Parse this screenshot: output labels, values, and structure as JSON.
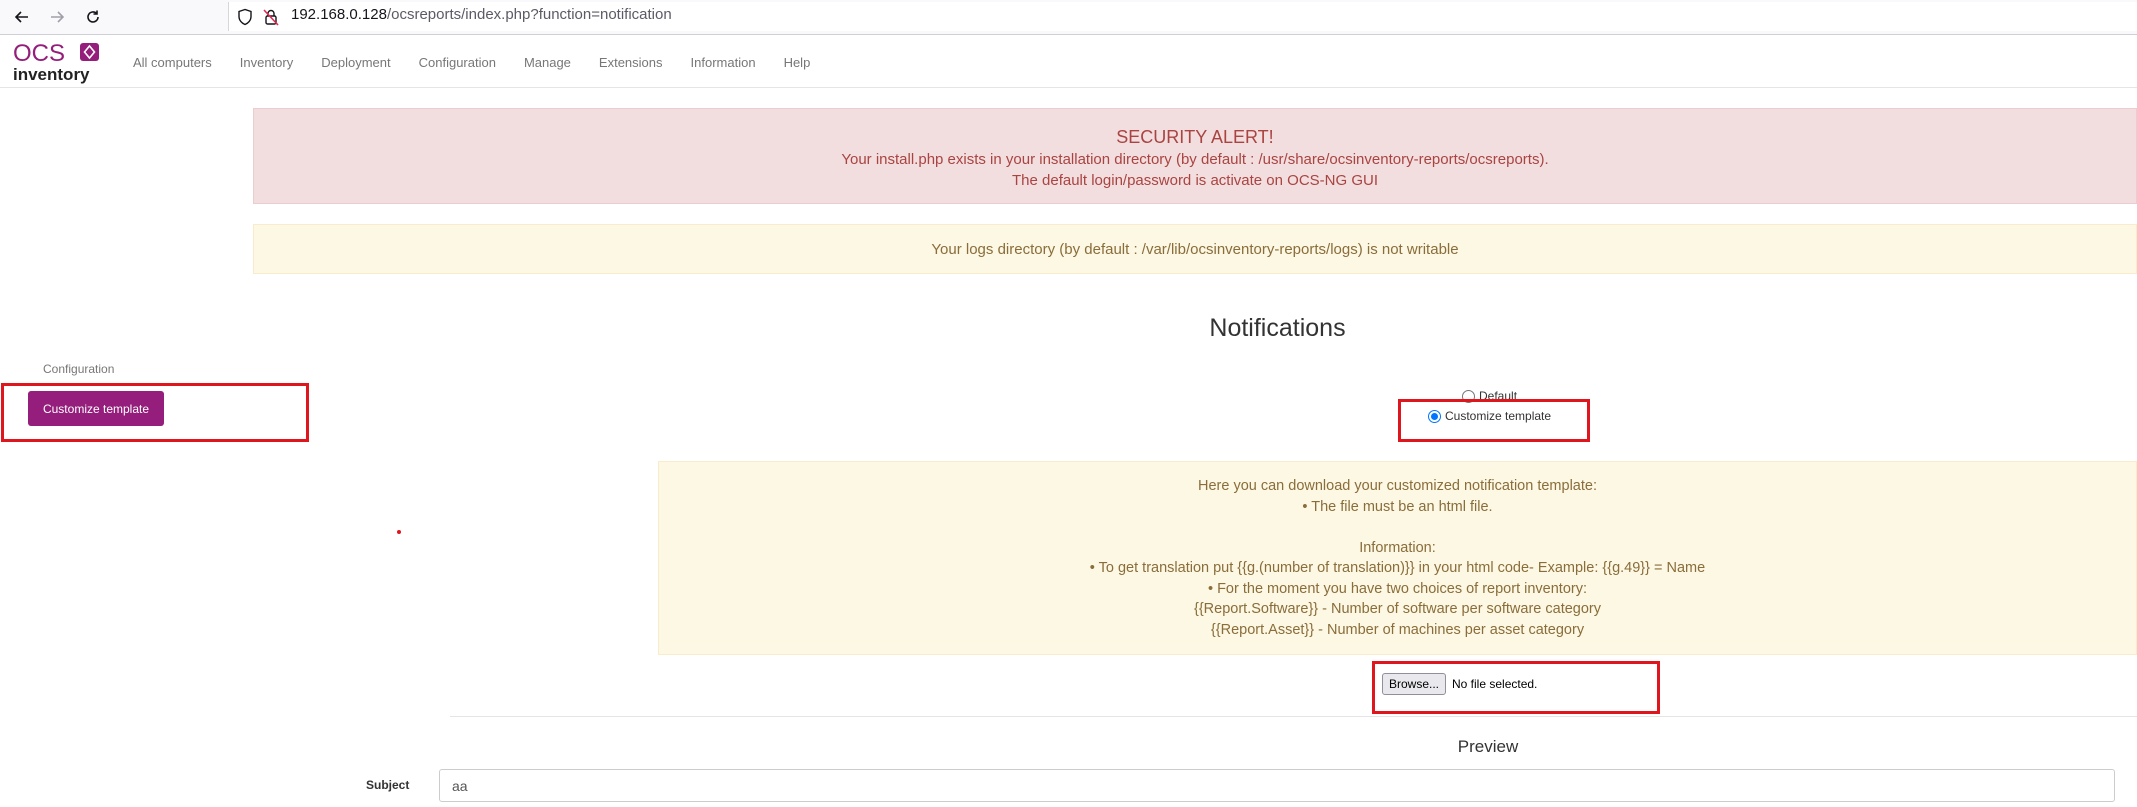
{
  "browser": {
    "url_host": "192.168.0.128",
    "url_path": "/ocsreports/index.php?function=notification",
    "icons": [
      "back-arrow-icon",
      "forward-arrow-icon",
      "reload-icon",
      "shield-icon",
      "insecure-lock-icon"
    ]
  },
  "app": {
    "logo_top": "OCS",
    "logo_bottom": "inventory",
    "brand_color": "#951e7c",
    "menu": [
      "All computers",
      "Inventory",
      "Deployment",
      "Configuration",
      "Manage",
      "Extensions",
      "Information",
      "Help"
    ]
  },
  "alerts": {
    "security_title": "SECURITY ALERT!",
    "security_line1": "Your install.php exists in your installation directory (by default : /usr/share/ocsinventory-reports/ocsreports).",
    "security_line2": "The default login/password is activate on OCS-NG GUI",
    "logs_warning": "Your logs directory (by default : /var/lib/ocsinventory-reports/logs) is not writable"
  },
  "page": {
    "title": "Notifications"
  },
  "sidebar": {
    "section_label": "Configuration",
    "button_label": "Customize template"
  },
  "options": {
    "default_label": "Default",
    "customize_label": "Customize template",
    "selected": "Customize template"
  },
  "info": {
    "lines": [
      "Here you can download your customized notification template:",
      "• The file must be an html file.",
      "",
      "Information:",
      "• To get translation put {{g.(number of translation)}} in your html code- Example: {{g.49}} = Name",
      "• For the moment you have two choices of report inventory:",
      "{{Report.Software}} - Number of software per software category",
      "{{Report.Asset}} - Number of machines per asset category"
    ]
  },
  "upload": {
    "browse_label": "Browse...",
    "status": "No file selected."
  },
  "preview": {
    "title": "Preview",
    "subject_label": "Subject",
    "subject_value": "aa"
  }
}
